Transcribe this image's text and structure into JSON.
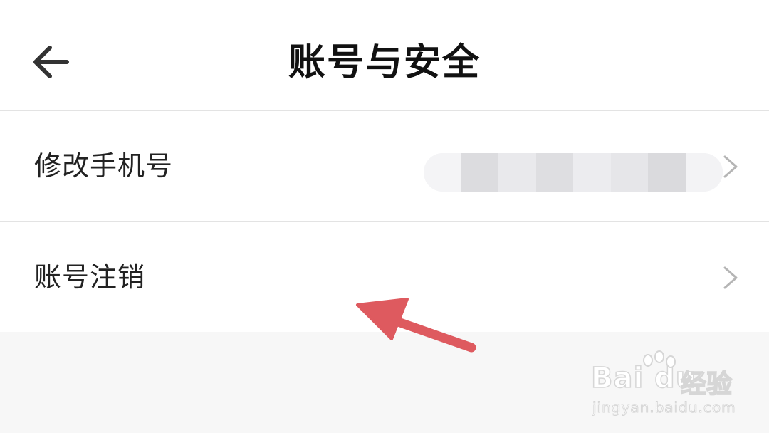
{
  "header": {
    "title": "账号与安全",
    "back_icon": "arrow-left-icon"
  },
  "settings": {
    "items": [
      {
        "label": "修改手机号",
        "value": "(obscured)",
        "icon": "chevron-right-icon"
      },
      {
        "label": "账号注销",
        "icon": "chevron-right-icon"
      }
    ]
  },
  "annotation": {
    "arrow_color": "#de5a5f"
  },
  "watermark": {
    "brand": "Bai du",
    "suffix": "经验",
    "url": "jingyan.baidu.com"
  }
}
